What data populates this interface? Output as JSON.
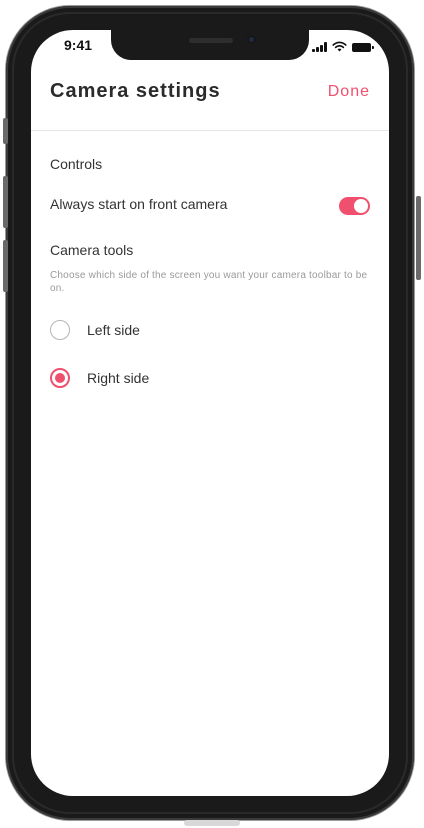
{
  "status_bar": {
    "time": "9:41",
    "icons": [
      "signal-icon",
      "wifi-icon",
      "battery-icon"
    ]
  },
  "header": {
    "title": "Camera settings",
    "done_label": "Done"
  },
  "controls": {
    "section_label": "Controls",
    "front_camera_label": "Always start on front camera",
    "front_camera_enabled": true
  },
  "camera_tools": {
    "section_label": "Camera tools",
    "helper_text": "Choose which side of the screen you want your camera toolbar to be on.",
    "options": [
      {
        "label": "Left side",
        "selected": false
      },
      {
        "label": "Right side",
        "selected": true
      }
    ]
  },
  "colors": {
    "accent": "#f0506e",
    "text": "#333333",
    "muted": "#9a9a9a"
  }
}
